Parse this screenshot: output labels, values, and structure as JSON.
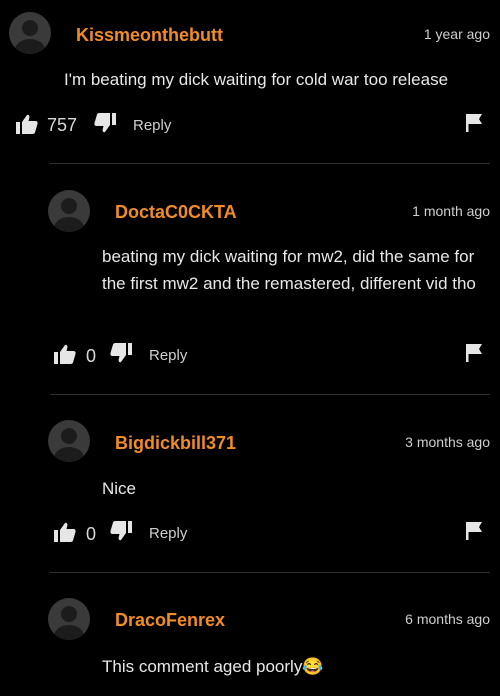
{
  "comments": [
    {
      "username": "Kissmeonthebutt",
      "time": "1 year ago",
      "text": "I'm beating my dick waiting for cold war too release",
      "likes": "757",
      "reply_label": "Reply"
    },
    {
      "username": "DoctaC0CKTA",
      "time": "1 month ago",
      "text": "beating my dick waiting for mw2, did the same for the first mw2 and the remastered, different vid tho",
      "likes": "0",
      "reply_label": "Reply"
    },
    {
      "username": "Bigdickbill371",
      "time": "3 months ago",
      "text": "Nice",
      "likes": "0",
      "reply_label": "Reply"
    },
    {
      "username": "DracoFenrex",
      "time": "6 months ago",
      "text": "This comment aged poorly",
      "emoji": "😂"
    }
  ],
  "colors": {
    "username": "#f08c28",
    "background": "#000000",
    "text": "#e8e8e8"
  },
  "icons": {
    "like": "thumbs-up-icon",
    "dislike": "thumbs-down-icon",
    "flag": "flag-icon",
    "avatar": "user-avatar-icon",
    "emoji": "tears-of-joy-emoji"
  }
}
